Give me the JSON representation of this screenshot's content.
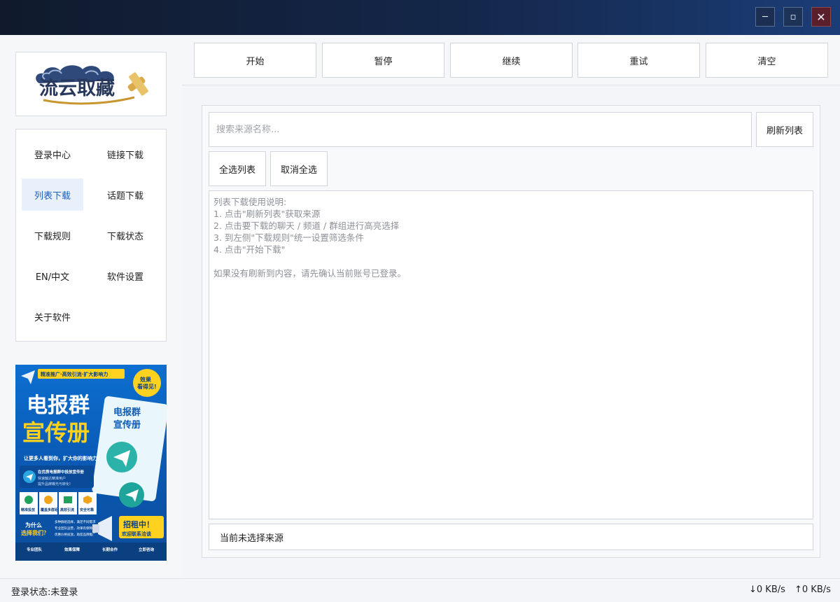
{
  "window": {
    "minimize_glyph": "─",
    "maximize_glyph": "▫",
    "close_glyph": "✕"
  },
  "logo": {
    "text": "流云取藏"
  },
  "sidebar": {
    "items": [
      {
        "label": "登录中心"
      },
      {
        "label": "链接下载"
      },
      {
        "label": "列表下载",
        "active": true
      },
      {
        "label": "话题下载"
      },
      {
        "label": "下载规则"
      },
      {
        "label": "下载状态"
      },
      {
        "label": "EN/中文"
      },
      {
        "label": "软件设置"
      },
      {
        "label": "关于软件"
      }
    ]
  },
  "ad": {
    "tagline": "精准推广·高效引流·扩大影响力",
    "badge_line1": "效果",
    "badge_line2": "看得见!",
    "title_line1": "电报群",
    "title_line2": "宣传册",
    "book_line1": "电报群",
    "book_line2": "宣传册",
    "slogan": "让更多人看到你，扩大你的影响力！",
    "info_line1": "在优质电报群中投放宣传册",
    "info_line2": "快速触达精准用户",
    "info_line3": "提升品牌曝光与转化!",
    "features": [
      "精准投放",
      "覆盖多群组",
      "高效引流",
      "安全可靠"
    ],
    "question_line1": "为什么",
    "question_line2": "选择我们？",
    "benefits": [
      "多种群组选择，满足不同需求",
      "专业团队运营，效果有保障",
      "优惠价格投放，助您品牌推广"
    ],
    "recruit_line1": "招租中！",
    "recruit_line2": "欢迎联系洽谈",
    "footer": [
      "专业团队",
      "效果保障",
      "长期合作",
      "立即咨询"
    ]
  },
  "toolbar": {
    "buttons": [
      "开始",
      "暂停",
      "继续",
      "重试",
      "清空"
    ]
  },
  "search": {
    "placeholder": "搜索来源名称...",
    "refresh_label": "刷新列表"
  },
  "selection": {
    "select_all": "全选列表",
    "deselect_all": "取消全选"
  },
  "instructions": {
    "lines": [
      "列表下载使用说明:",
      "1. 点击\"刷新列表\"获取来源",
      "2. 点击要下载的聊天 / 频道 / 群组进行高亮选择",
      "3. 到左侧\"下载规则\"统一设置筛选条件",
      "4. 点击\"开始下载\"",
      "",
      "如果没有刷新到内容，请先确认当前账号已登录。"
    ]
  },
  "source_status": "当前未选择来源",
  "statusbar": {
    "login": "登录状态:未登录",
    "download": "↓0 KB/s",
    "upload": "↑0 KB/s"
  },
  "colors": {
    "titlebar_start": "#101a2c",
    "titlebar_end": "#1b3d77",
    "active_nav_bg": "#e8f0fb",
    "active_nav_text": "#1d5fbf",
    "ad_yellow": "#ffd21f",
    "ad_blue": "#0b5cb8"
  }
}
